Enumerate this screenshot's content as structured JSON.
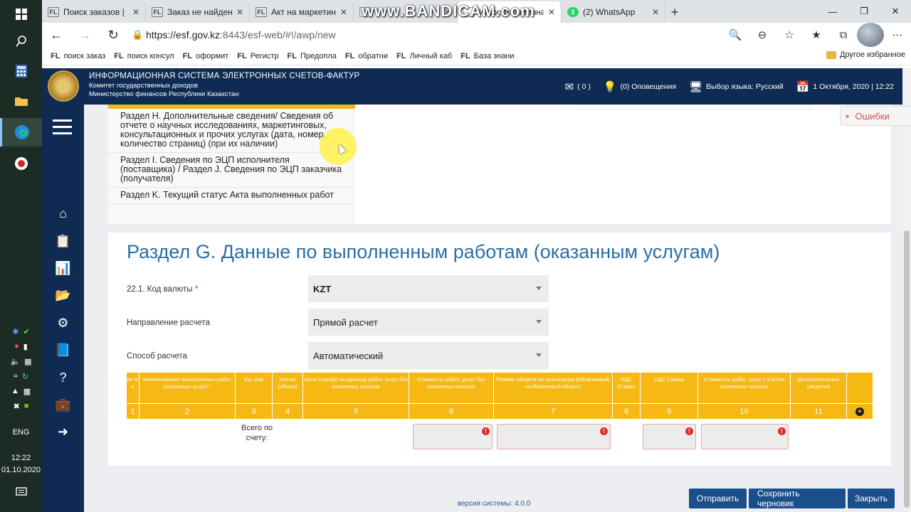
{
  "browser": {
    "tabs": [
      {
        "favicon": "FL",
        "label": "Поиск заказов |"
      },
      {
        "favicon": "FL",
        "label": "Заказ не найден"
      },
      {
        "favicon": "FL",
        "label": "Акт на маркетинг"
      },
      {
        "favicon": "page-icon",
        "label": ""
      },
      {
        "favicon": "page-icon",
        "label": "Информационна"
      },
      {
        "favicon": "2",
        "label": "(2) WhatsApp"
      }
    ],
    "watermark": "www.BANDICAM.com",
    "url_host": "https://esf.gov.kz",
    "url_path": ":8443/esf-web/#!/awp/new",
    "bookmarks": [
      {
        "fl": "FL",
        "label": "поиск заказ"
      },
      {
        "fl": "FL",
        "label": "поиск консул"
      },
      {
        "fl": "FL",
        "label": "оформит"
      },
      {
        "fl": "FL",
        "label": "Регистр"
      },
      {
        "fl": "FL",
        "label": "Предопла"
      },
      {
        "fl": "FL",
        "label": "обратни"
      },
      {
        "fl": "FL",
        "label": "Личный каб"
      },
      {
        "fl": "FL",
        "label": "База знани"
      }
    ],
    "other_favorites": "Другое избранное"
  },
  "header": {
    "title": "ИНФОРМАЦИОННАЯ СИСТЕМА ЭЛЕКТРОННЫХ СЧЕТОВ-ФАКТУР",
    "sub1": "Комитет государственных доходов",
    "sub2": "Министерство финансов Республики Казахстан",
    "messages": "( 0 )",
    "notifications": "(0) Оповещения",
    "language": "Выбор языка: Русский",
    "datetime": "1 Октября, 2020 | 12:22"
  },
  "errors_button": "Ошибки",
  "sections": [
    {
      "label": "Раздел H. Дополнительные сведения/ Сведения об отчете о научных исследованиях, маркетинговых, консультационных и прочих услугах (дата, номер, количество страниц) (при их наличии)"
    },
    {
      "label": "Раздел I. Сведения по ЭЦП исполнителя (поставщика) / Раздел J. Сведения по ЭЦП заказчика (получателя)"
    },
    {
      "label": "Раздел K. Текущий статус Акта выполненных работ"
    }
  ],
  "form": {
    "title": "Раздел G. Данные по выполненным работам (оказанным услугам)",
    "currency_label": "22.1. Код валюты",
    "currency_required": "*",
    "currency_value": "KZT",
    "direction_label": "Направление расчета",
    "direction_value": "Прямой расчет",
    "method_label": "Способ расчета",
    "method_value": "Автоматический"
  },
  "table": {
    "headers": [
      "№ п/п",
      "Наименование выполненных работ (оказанных услуг) *",
      "Ед. изм",
      "Кол-во (объем)",
      "Цена (тариф) за единицу работ, услуг без косвенных налогов",
      "Стоимость работ, услуг без косвенных налогов",
      "Размер оборота по реализации (облагаемый/необлагаемый оборот)",
      "НДС Ставка",
      "НДС Сумма",
      "Стоимость работ, услуг с учетом косвенных налогов",
      "Дополнительные сведения",
      ""
    ],
    "numbers": [
      "1",
      "2",
      "3",
      "4",
      "5",
      "6",
      "7",
      "8",
      "9",
      "10",
      "11"
    ],
    "total_label": "Всего по счету:"
  },
  "footer": {
    "version": "версия системы: 4.0.0",
    "send": "Отправить",
    "save_draft": "Сохранить черновик",
    "close": "Закрыть"
  },
  "taskbar": {
    "lang": "ENG",
    "time": "12:22",
    "date": "01.10.2020"
  }
}
